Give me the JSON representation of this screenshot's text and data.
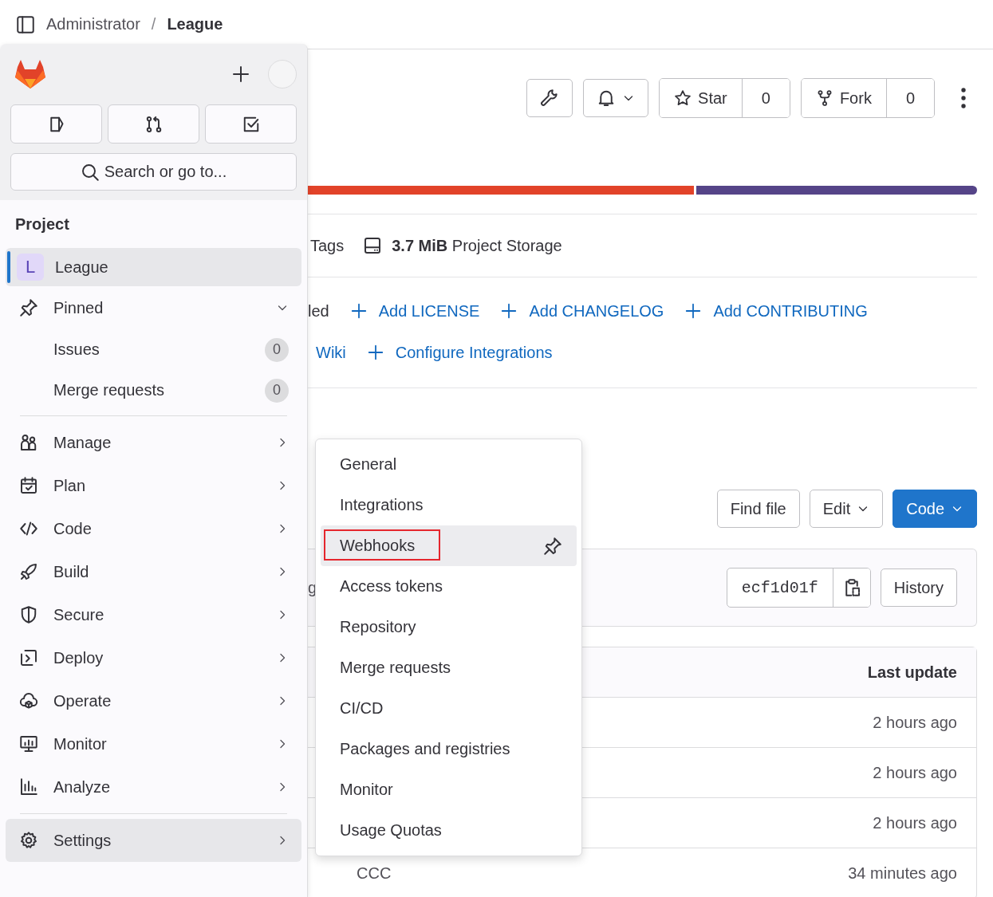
{
  "breadcrumbs": [
    {
      "label": "Administrator",
      "current": false
    },
    {
      "label": "League",
      "current": true
    }
  ],
  "breadcrumb_separator": "/",
  "sidebar": {
    "search": {
      "placeholder": "Search or go to..."
    },
    "section_title": "Project",
    "project": {
      "avatar": "L",
      "label": "League",
      "selected": true
    },
    "pinned": {
      "label": "Pinned",
      "expanded": true,
      "children": [
        {
          "label": "Issues",
          "count": "0"
        },
        {
          "label": "Merge requests",
          "count": "0"
        }
      ]
    },
    "menu": [
      {
        "label": "Manage",
        "selected": false
      },
      {
        "label": "Plan",
        "selected": false
      },
      {
        "label": "Code",
        "selected": false
      },
      {
        "label": "Build",
        "selected": false
      },
      {
        "label": "Secure",
        "selected": false
      },
      {
        "label": "Deploy",
        "selected": false
      },
      {
        "label": "Operate",
        "selected": false
      },
      {
        "label": "Monitor",
        "selected": false
      },
      {
        "label": "Analyze",
        "selected": false
      }
    ],
    "settings": {
      "label": "Settings",
      "selected": true
    }
  },
  "settings_flyout": [
    {
      "label": "General",
      "selected": false
    },
    {
      "label": "Integrations",
      "selected": false
    },
    {
      "label": "Webhooks",
      "selected": true
    },
    {
      "label": "Access tokens",
      "selected": false
    },
    {
      "label": "Repository",
      "selected": false
    },
    {
      "label": "Merge requests",
      "selected": false
    },
    {
      "label": "CI/CD",
      "selected": false
    },
    {
      "label": "Packages and registries",
      "selected": false
    },
    {
      "label": "Monitor",
      "selected": false
    },
    {
      "label": "Usage Quotas",
      "selected": false
    }
  ],
  "project_actions": {
    "star": {
      "label": "Star",
      "count": "0"
    },
    "fork": {
      "label": "Fork",
      "count": "0"
    }
  },
  "language_bar": [
    {
      "color": "#e24329"
    },
    {
      "color": "#554488"
    }
  ],
  "stats": {
    "tags": "Tags",
    "storage": "**3.7 MiB** Project Storage"
  },
  "quick_links": [
    [
      {
        "kind": "text",
        "label": "led"
      },
      {
        "kind": "add",
        "label": "Add LICENSE"
      },
      {
        "kind": "add",
        "label": "Add CHANGELOG"
      },
      {
        "kind": "add",
        "label": "Add CONTRIBUTING"
      }
    ],
    [
      {
        "kind": "link",
        "label": "Wiki"
      },
      {
        "kind": "add",
        "label": "Configure Integrations"
      }
    ]
  ],
  "repo_buttons": [
    {
      "label": "Find file",
      "kind": "plain"
    },
    {
      "label": "Edit",
      "kind": "dropdown"
    },
    {
      "label": "Code",
      "kind": "primary"
    }
  ],
  "commit": {
    "message": "g",
    "sha": "ecf1d01f",
    "history": "History"
  },
  "files": {
    "header": "Last update",
    "rows": [
      {
        "updated": "2 hours ago"
      },
      {
        "updated": "2 hours ago"
      },
      {
        "updated": "2 hours ago"
      },
      {
        "name": "CCC",
        "updated": "34 minutes ago"
      }
    ]
  }
}
